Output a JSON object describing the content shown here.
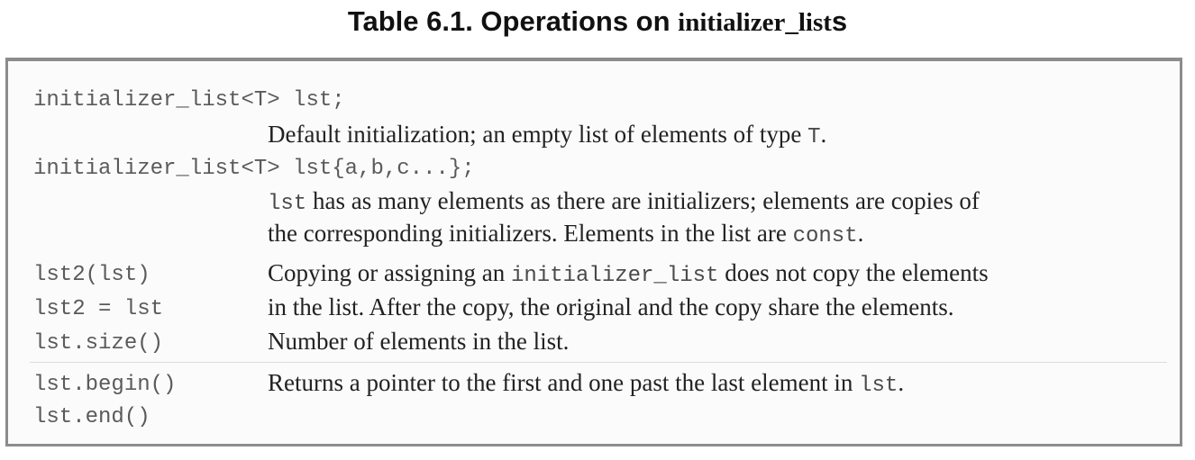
{
  "title": {
    "prefix": "Table 6.1. Operations on ",
    "code": "initializer_list",
    "suffix": "s"
  },
  "rows": [
    {
      "code_lines": [
        "initializer_list<T> lst;"
      ],
      "description": [
        [
          {
            "t": "Default initialization; an empty list of elements of type "
          },
          {
            "t": "T",
            "code": true
          },
          {
            "t": "."
          }
        ]
      ]
    },
    {
      "code_lines": [
        "initializer_list<T> lst{a,b,c...};"
      ],
      "description": [
        [
          {
            "t": "lst",
            "code": true
          },
          {
            "t": " has as many elements as there are initializers; elements are copies of"
          }
        ],
        [
          {
            "t": "the corresponding initializers. Elements in the list are "
          },
          {
            "t": "const",
            "code": true
          },
          {
            "t": "."
          }
        ]
      ]
    },
    {
      "code_lines": [
        "lst2(lst)",
        "lst2 = lst"
      ],
      "description": [
        [
          {
            "t": "Copying or assigning an "
          },
          {
            "t": "initializer_list",
            "code": true
          },
          {
            "t": " does not copy the elements"
          }
        ],
        [
          {
            "t": "in the list. After the copy, the original and the copy share the elements."
          }
        ]
      ]
    },
    {
      "code_lines": [
        "lst.size()"
      ],
      "description": [
        [
          {
            "t": "Number of elements in the list."
          }
        ]
      ]
    },
    {
      "code_lines": [
        "lst.begin()",
        "lst.end()"
      ],
      "description": [
        [
          {
            "t": "Returns a pointer to the first and one past the last element in "
          },
          {
            "t": "lst",
            "code": true
          },
          {
            "t": "."
          }
        ]
      ]
    }
  ]
}
